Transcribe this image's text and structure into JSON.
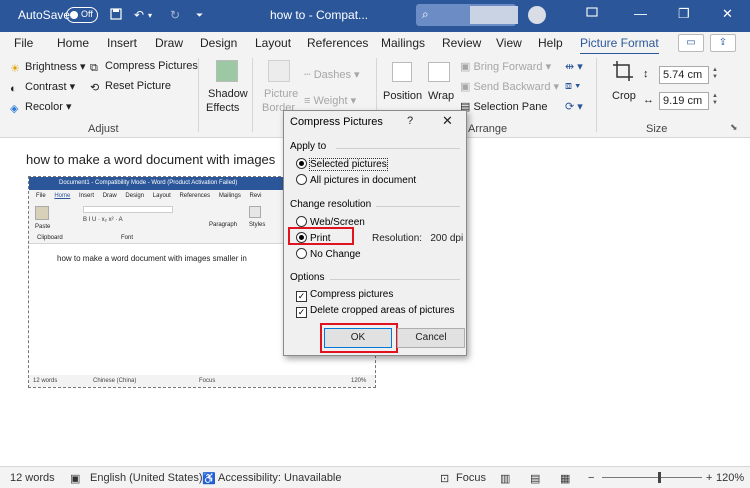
{
  "titlebar": {
    "autosave_label": "AutoSave",
    "autosave_state": "Off",
    "doc_title": "how to  -  Compat...",
    "minimize": "—",
    "restore": "❐",
    "close": "✕"
  },
  "menu": {
    "tabs": [
      "File",
      "Home",
      "Insert",
      "Draw",
      "Design",
      "Layout",
      "References",
      "Mailings",
      "Review",
      "View",
      "Help",
      "Picture Format"
    ],
    "active_tab": "Picture Format"
  },
  "ribbon": {
    "adjust": {
      "brightness": "Brightness",
      "contrast": "Contrast",
      "recolor": "Recolor",
      "compress": "Compress Pictures",
      "reset": "Reset Picture",
      "group_label": "Adjust"
    },
    "shadow_effects": [
      "Shadow",
      "Effects"
    ],
    "picture_border": [
      "Picture",
      "Border"
    ],
    "dashes": "Dashes",
    "weight": "Weight",
    "position": "Position",
    "wrap_text": [
      "Wrap",
      "Text"
    ],
    "bring_forward": "Bring Forward",
    "send_backward": "Send Backward",
    "selection_pane": "Selection Pane",
    "arrange_label": "Arrange",
    "crop": "Crop",
    "height": "5.74 cm",
    "width": "9.19 cm",
    "size_label": "Size"
  },
  "document": {
    "heading_text": "how to make a word document with images",
    "embedded": {
      "title": "Document1  -  Compatibility Mode  -  Word (Product Activation Failed)",
      "tabs": [
        "File",
        "Home",
        "Insert",
        "Draw",
        "Design",
        "Layout",
        "References",
        "Mailings",
        "Revi"
      ],
      "paste": "Paste",
      "clipboard": "Clipboard",
      "font_group": "Font",
      "paragraph": "Paragraph",
      "styles": "Styles",
      "line": "how to make a word document with images smaller in",
      "words": "12 words",
      "language": "Chinese (China)",
      "focus": "Focus",
      "zoom": "120%"
    }
  },
  "dialog": {
    "title": "Compress Pictures",
    "help": "?",
    "close": "✕",
    "apply_to": "Apply to",
    "selected_pictures": "Selected pictures",
    "all_pictures": "All pictures in document",
    "change_resolution": "Change resolution",
    "web_screen": "Web/Screen",
    "print": "Print",
    "no_change": "No Change",
    "resolution_label": "Resolution:",
    "resolution_value": "200 dpi",
    "options": "Options",
    "compress_pictures": "Compress pictures",
    "delete_cropped": "Delete cropped areas of pictures",
    "ok": "OK",
    "cancel": "Cancel"
  },
  "statusbar": {
    "words": "12 words",
    "language": "English (United States)",
    "accessibility": "Accessibility: Unavailable",
    "focus": "Focus",
    "zoom_minus": "−",
    "zoom_plus": "+",
    "zoom": "120%"
  }
}
